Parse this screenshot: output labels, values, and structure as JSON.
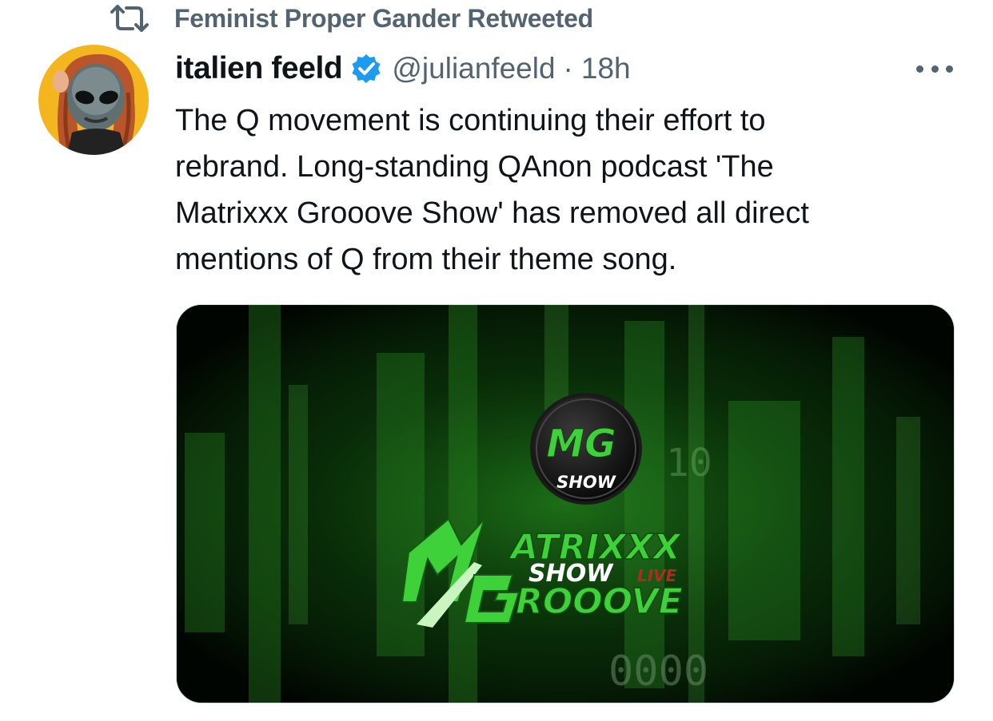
{
  "retweet": {
    "icon": "retweet-icon",
    "text": "Feminist Proper Gander Retweeted"
  },
  "tweet": {
    "avatar_icon": "alien-avatar",
    "display_name": "italien feeld",
    "verified_icon": "verified-badge-icon",
    "handle": "@julianfeeld",
    "separator": "·",
    "time": "18h",
    "more_icon": "more-options-icon",
    "text_lines": [
      "The Q movement is continuing their effort to",
      "rebrand. Long-standing QAnon podcast 'The",
      "Matrixxx Grooove Show' has removed all direct",
      "mentions of Q from their theme song."
    ]
  },
  "media": {
    "logo_badge_top": "MG",
    "logo_badge_bottom": "SHOW",
    "title_line1": "ATRIXXX",
    "title_show": "SHOW",
    "title_live": "LIVE",
    "title_line2": "ROOOVE",
    "background_digits": "0000",
    "background_digits_2": "10",
    "colors": {
      "accent_green": "#3fd13a",
      "dark_green": "#0b3a0a",
      "live_red": "#b22a1f"
    }
  },
  "colors": {
    "text_primary": "#0f1419",
    "text_secondary": "#536471",
    "verified_blue": "#1d9bf0"
  }
}
